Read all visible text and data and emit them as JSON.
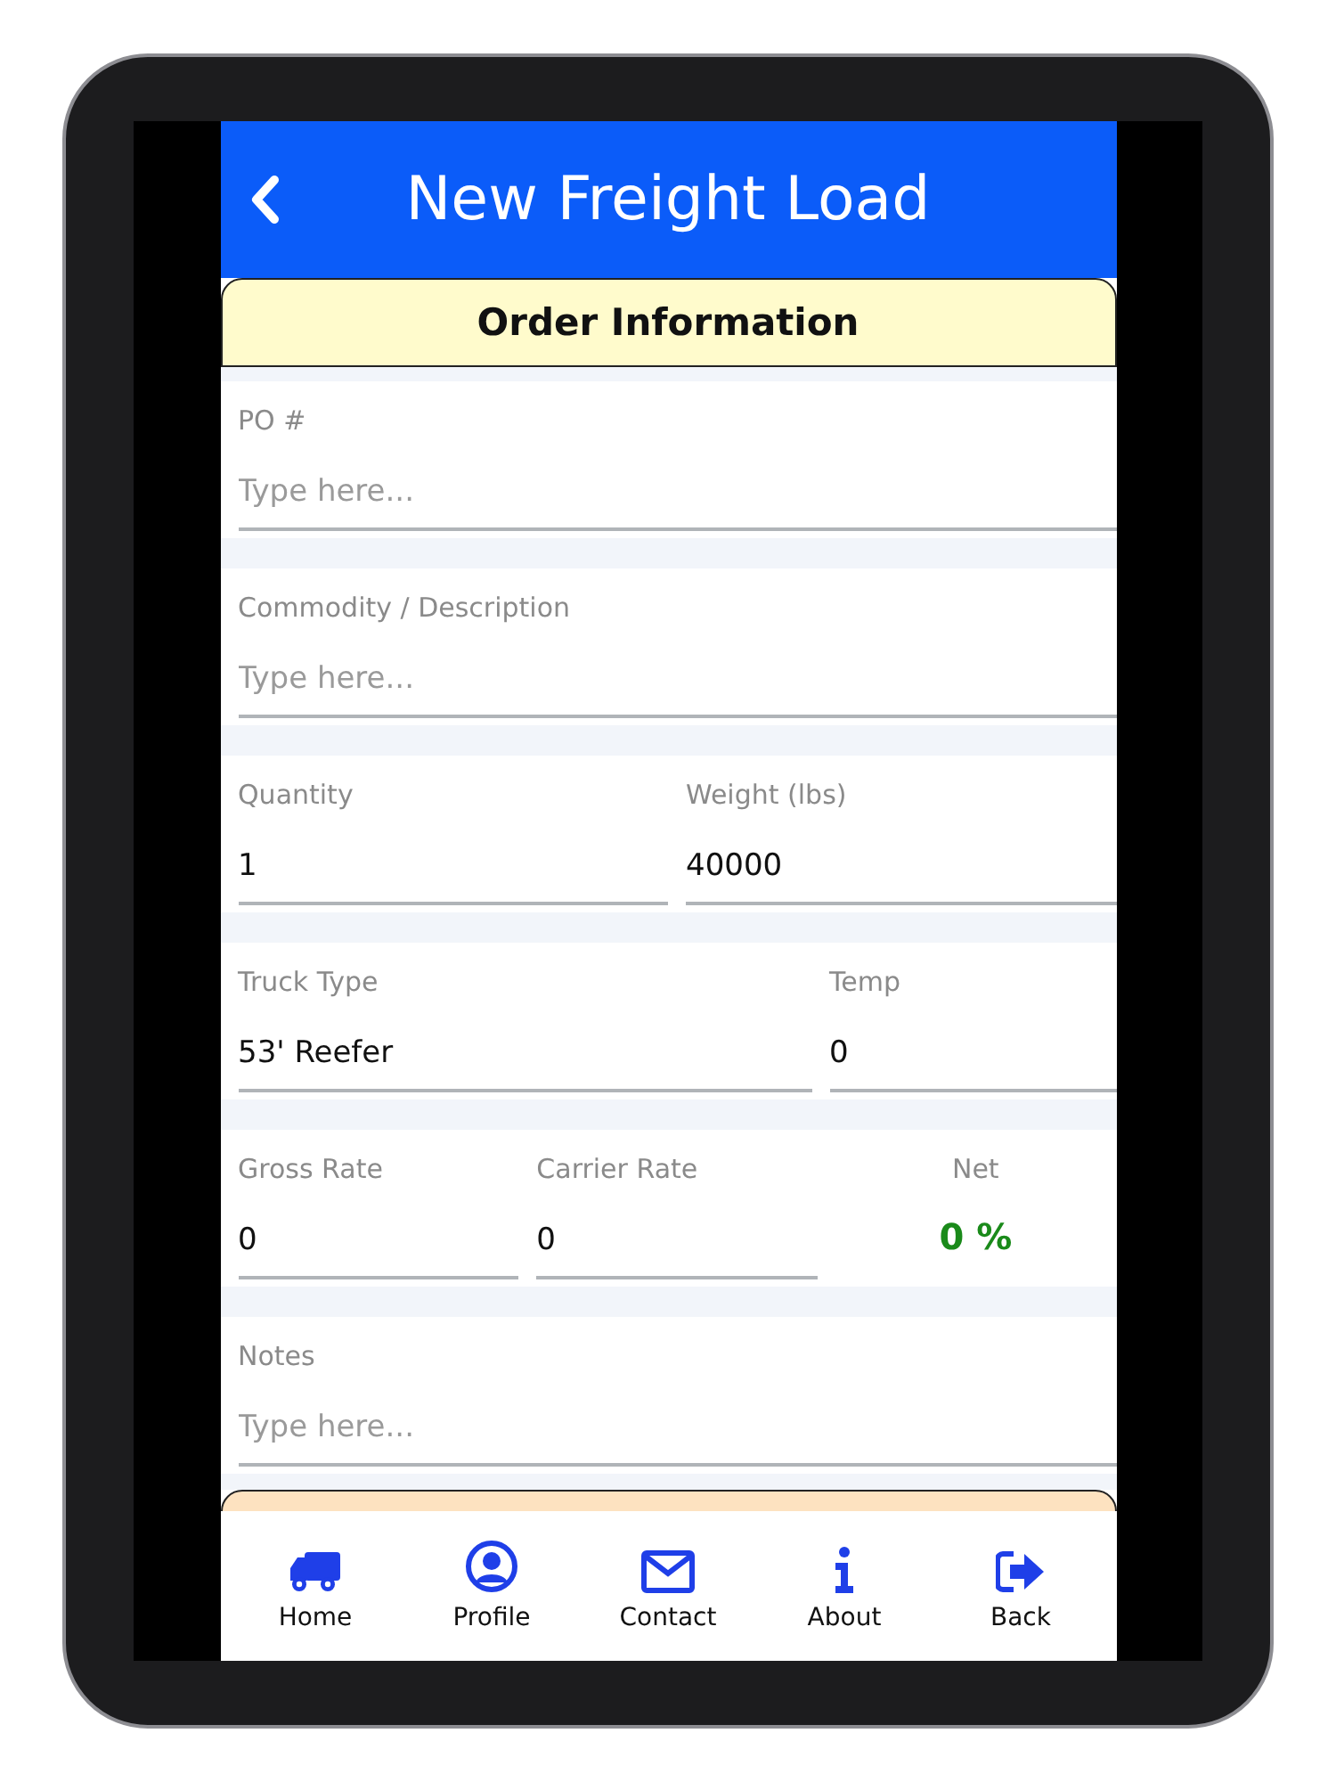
{
  "header": {
    "title": "New Freight Load"
  },
  "sections": [
    {
      "title": "Order Information",
      "color": "#fffbcc",
      "rows": [
        [
          {
            "kind": "input",
            "label": "PO #",
            "placeholder": "Type here..."
          }
        ],
        [
          {
            "kind": "input",
            "label": "Commodity / Description",
            "placeholder": "Type here..."
          }
        ],
        [
          {
            "kind": "input",
            "label": "Quantity",
            "value": "1"
          },
          {
            "kind": "input",
            "label": "Weight (lbs)",
            "value": "40000"
          }
        ],
        [
          {
            "kind": "input",
            "label": "Truck Type",
            "value": "53' Reefer"
          },
          {
            "kind": "input",
            "label": "Temp",
            "value": "0"
          }
        ],
        [
          {
            "kind": "input",
            "label": "Gross Rate",
            "value": "0"
          },
          {
            "kind": "input",
            "label": "Carrier Rate",
            "value": "0"
          },
          {
            "kind": "readout",
            "label": "Net",
            "value": "0 %"
          }
        ],
        [
          {
            "kind": "input",
            "label": "Notes",
            "placeholder": "Type here..."
          }
        ]
      ]
    },
    {
      "color": "#fde2c0"
    }
  ],
  "nav": [
    {
      "label": "Home"
    },
    {
      "label": "Profile"
    },
    {
      "label": "Contact"
    },
    {
      "label": "About"
    },
    {
      "label": "Back"
    }
  ]
}
